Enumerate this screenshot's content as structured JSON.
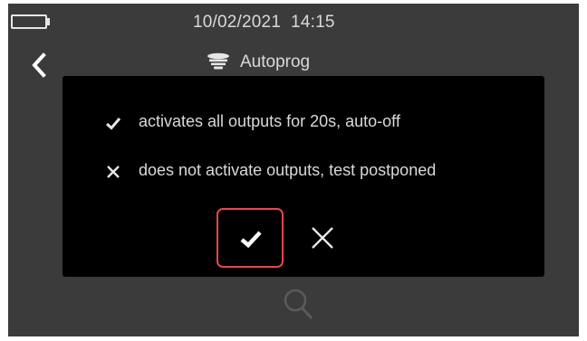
{
  "status_bar": {
    "datetime": "10/02/2021  14:15",
    "battery_icon": "battery-empty-icon"
  },
  "header": {
    "title": "Autoprog",
    "back_icon": "chevron-left-icon",
    "device_icon": "siren-icon"
  },
  "dialog": {
    "options": [
      {
        "icon": "check-icon",
        "text": "activates all outputs for 20s, auto-off"
      },
      {
        "icon": "close-icon",
        "text": "does not activate outputs, test postponed"
      }
    ],
    "confirm_icon": "check-icon",
    "cancel_icon": "close-icon"
  },
  "footer": {
    "search_icon": "search-icon"
  },
  "colors": {
    "panel_background": "#3b3b3b",
    "dialog_background": "#000000",
    "accent_border": "#e8474f",
    "text": "#d9d9d9"
  }
}
